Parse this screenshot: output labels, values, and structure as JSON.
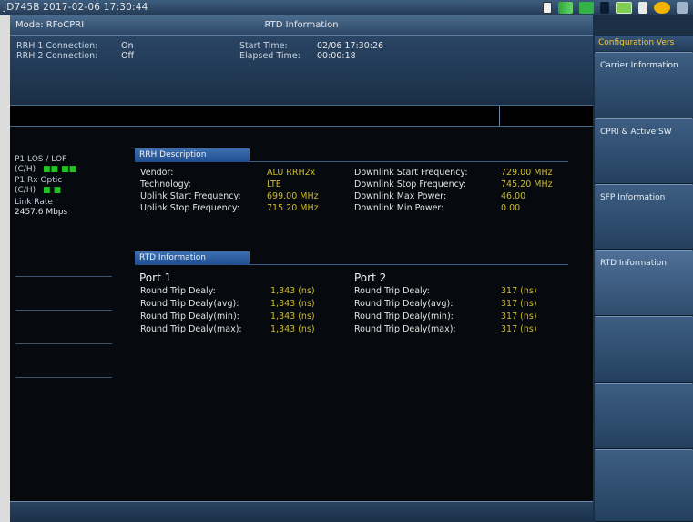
{
  "status_bar": {
    "title": "JD745B   2017-02-06  17:30:44"
  },
  "header": {
    "mode": "Mode: RFoCPRI",
    "title": "RTD Information"
  },
  "connections": {
    "rrh1_label": "RRH 1 Connection:",
    "rrh1_value": "On",
    "rrh2_label": "RRH 2 Connection:",
    "rrh2_value": "Off",
    "start_label": "Start Time:",
    "start_value": "02/06 17:30:26",
    "elapsed_label": "Elapsed Time:",
    "elapsed_value": "00:00:18"
  },
  "left_panel": {
    "p1_los": "P1   LOS  /  LOF",
    "ch1": "(C/H)",
    "ind1": "■■    ■■",
    "p1_rx": "P1    Rx Optic",
    "ch2": "(C/H)",
    "ind2": "■         ■",
    "link_rate_label": "Link Rate",
    "link_rate_value": "2457.6 Mbps"
  },
  "rrh_description": {
    "section_title": "RRH Description",
    "vendor_label": "Vendor:",
    "vendor_value": "ALU RRH2x",
    "technology_label": "Technology:",
    "technology_value": "LTE",
    "ul_start_label": "Uplink Start Frequency:",
    "ul_start_value": "699.00 MHz",
    "ul_stop_label": "Uplink Stop Frequency:",
    "ul_stop_value": "715.20 MHz",
    "dl_start_label": "Downlink Start Frequency:",
    "dl_start_value": "729.00 MHz",
    "dl_stop_label": "Downlink Stop Frequency:",
    "dl_stop_value": "745.20 MHz",
    "dl_max_label": "Downlink Max Power:",
    "dl_max_value": "46.00",
    "dl_min_label": "Downlink Min Power:",
    "dl_min_value": "0.00"
  },
  "rtd_information": {
    "section_title": "RTD Information",
    "port1": {
      "title": "Port 1",
      "rows": [
        {
          "label": "Round Trip Dealy:",
          "value": "1,343 (ns)"
        },
        {
          "label": "Round Trip Dealy(avg):",
          "value": "1,343 (ns)"
        },
        {
          "label": "Round Trip Dealy(min):",
          "value": "1,343 (ns)"
        },
        {
          "label": "Round Trip Dealy(max):",
          "value": "1,343 (ns)"
        }
      ]
    },
    "port2": {
      "title": "Port 2",
      "rows": [
        {
          "label": "Round Trip Dealy:",
          "value": "317 (ns)"
        },
        {
          "label": "Round Trip Dealy(avg):",
          "value": "317 (ns)"
        },
        {
          "label": "Round Trip Dealy(min):",
          "value": "317 (ns)"
        },
        {
          "label": "Round Trip Dealy(max):",
          "value": "317 (ns)"
        }
      ]
    }
  },
  "softkeys": {
    "header": "Configuration Vers",
    "items": [
      {
        "label": "Carrier Information"
      },
      {
        "label": "CPRI & Active SW"
      },
      {
        "label": "SFP Information"
      },
      {
        "label": "RTD Information"
      },
      {
        "label": ""
      },
      {
        "label": ""
      },
      {
        "label": ""
      }
    ]
  },
  "colors": {
    "accent": "#f4c830",
    "value_yellow": "#cdbb32",
    "indicator_green": "#22c322"
  }
}
